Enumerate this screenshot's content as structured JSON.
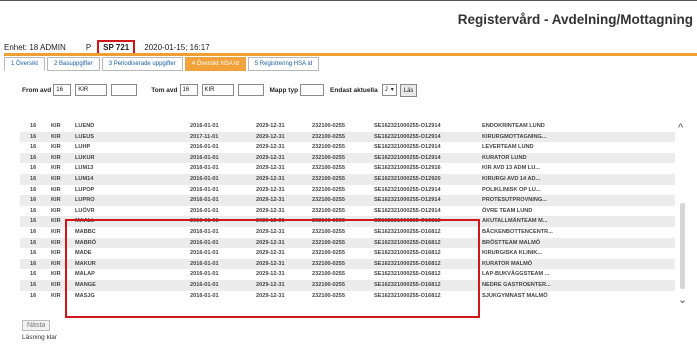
{
  "app": {
    "title": "Registervård - Avdelning/Mottagning"
  },
  "header": {
    "unit": "Enhet: 18 ADMIN",
    "p_label": "P",
    "p_code": "SP 721",
    "timestamp": "2020-01-15; 16:17"
  },
  "tabs": [
    {
      "label": "1 Översikt"
    },
    {
      "label": "2 Basuppgifter"
    },
    {
      "label": "3 Periodiserade uppgifter"
    },
    {
      "label": "4 Översikt HSA id"
    },
    {
      "label": "5 Registrering HSA id"
    }
  ],
  "filter": {
    "from_label": "From avd",
    "from_num": "16",
    "from_code": "KIR",
    "from_extra": "",
    "tom_label": "Tom avd",
    "tom_num": "16",
    "tom_code": "KIR",
    "tom_extra": "",
    "mapp_label": "Mapp typ",
    "mapp_value": "",
    "endast_label": "Endast aktuella",
    "endast_value": "J",
    "search_btn": "Läs"
  },
  "rows": [
    [
      "16",
      "KIR",
      "LUEND",
      "2016-01-01",
      "2029-12-31",
      "232100-0255",
      "SE162321000255-O12914",
      "ENDOKRINTEAM LUND"
    ],
    [
      "16",
      "KIR",
      "LUEUS",
      "2017-11-01",
      "2029-12-31",
      "232100-0255",
      "SE162321000255-O12914",
      "KIRURGMOTTAGNING..."
    ],
    [
      "16",
      "KIR",
      "LUHP",
      "2016-01-01",
      "2029-12-31",
      "232100-0255",
      "SE162321000255-O12914",
      "LEVERTEAM LUND"
    ],
    [
      "16",
      "KIR",
      "LUKUR",
      "2016-01-01",
      "2029-12-31",
      "232100-0255",
      "SE162321000255-O12914",
      "KURATOR LUND"
    ],
    [
      "16",
      "KIR",
      "LUM13",
      "2016-01-01",
      "2029-12-31",
      "232100-0255",
      "SE162321000255-O12916",
      "KIR AVD 13 ADM LU..."
    ],
    [
      "16",
      "KIR",
      "LUM14",
      "2016-01-01",
      "2029-12-31",
      "232100-0255",
      "SE162321000255-O12920",
      "KIRURGI AVD 14 AD..."
    ],
    [
      "16",
      "KIR",
      "LUPOP",
      "2016-01-01",
      "2029-12-31",
      "232100-0255",
      "SE162321000255-O12914",
      "POLIKLINISK OP LU..."
    ],
    [
      "16",
      "KIR",
      "LUPRO",
      "2016-01-01",
      "2029-12-31",
      "232100-0255",
      "SE162321000255-O12914",
      "PROTESUTPROVNING..."
    ],
    [
      "16",
      "KIR",
      "LUÖVR",
      "2016-01-01",
      "2029-12-31",
      "232100-0255",
      "SE162321000255-O12914",
      "ÖVRE TEAM LUND"
    ],
    [
      "16",
      "KIR",
      "MAALL",
      "2016-01-01",
      "2029-12-31",
      "232100-0255",
      "SE162321000255-O16812",
      "AKUTALLMÄNTEAM M..."
    ],
    [
      "16",
      "KIR",
      "MABBC",
      "2016-01-01",
      "2029-12-31",
      "232100-0255",
      "SE162321000255-O16812",
      "BÄCKENBOTTENCENTR..."
    ],
    [
      "16",
      "KIR",
      "MABRÖ",
      "2016-01-01",
      "2029-12-31",
      "232100-0255",
      "SE162321000255-O16812",
      "BRÖSTTEAM MALMÖ"
    ],
    [
      "16",
      "KIR",
      "MADE",
      "2016-01-01",
      "2029-12-31",
      "232100-0255",
      "SE162321000255-O16812",
      "KIRURGISKA KLINIK..."
    ],
    [
      "16",
      "KIR",
      "MAKUR",
      "2016-01-01",
      "2029-12-31",
      "232100-0255",
      "SE162321000255-O16812",
      "KURATOR MALMÖ"
    ],
    [
      "16",
      "KIR",
      "MALAP",
      "2016-01-01",
      "2029-12-31",
      "232100-0255",
      "SE162321000255-O16812",
      "LAP-BUKVÄGGSTEAM ..."
    ],
    [
      "16",
      "KIR",
      "MANGE",
      "2016-01-01",
      "2029-12-31",
      "232100-0255",
      "SE162321000255-O16812",
      "NEDRE GASTROENTER..."
    ],
    [
      "16",
      "KIR",
      "MASJG",
      "2016-01-01",
      "2029-12-31",
      "232100-0255",
      "SE162321000255-O16812",
      "SJUKGYMNAST MALMÖ"
    ]
  ],
  "footer": {
    "next_btn": "Nästa",
    "status": "Läsning klar"
  },
  "icons": {
    "scroll_up": "chevron-up-icon",
    "scroll_down": "chevron-down-icon",
    "select_caret": "chevron-down-icon"
  },
  "colors": {
    "accent_orange": "#f2a23a",
    "highlight_red": "#d01818",
    "tab_link_blue": "#1a5ea8"
  }
}
